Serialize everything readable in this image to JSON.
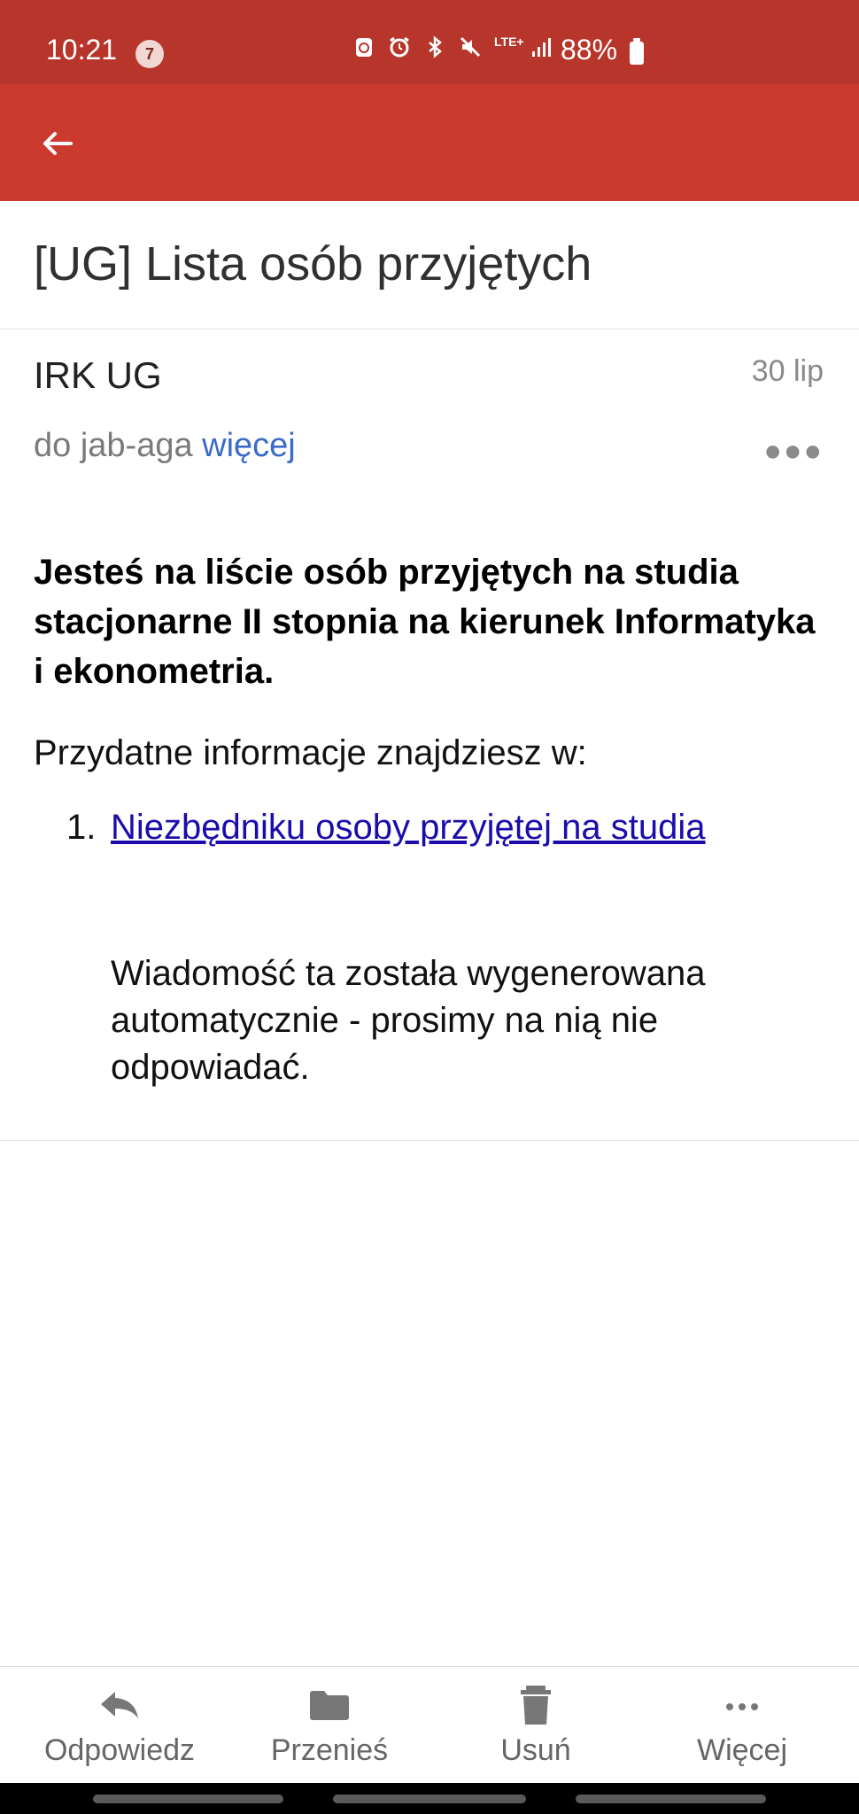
{
  "status_bar": {
    "time": "10:21",
    "notification_count": "7",
    "network": "LTE+",
    "battery": "88%"
  },
  "email": {
    "subject": "[UG] Lista osób przyjętych",
    "sender": "IRK UG",
    "date": "30 lip",
    "recipient_prefix": "do jab-aga",
    "more_label": "więcej",
    "heading": "Jesteś na liście osób przyjętych na studia stacjonarne II stopnia na kierunek Informatyka i ekonometria.",
    "intro": "Przydatne informacje znajdziesz w:",
    "list": [
      {
        "number": "1.",
        "link_text": "Niezbędniku osoby przyjętej na studia"
      }
    ],
    "auto_note": "Wiadomość ta została wygenerowana automatycznie - prosimy na nią nie odpowiadać."
  },
  "actions": [
    {
      "label": "Odpowiedz",
      "icon": "reply-icon"
    },
    {
      "label": "Przenieś",
      "icon": "folder-icon"
    },
    {
      "label": "Usuń",
      "icon": "trash-icon"
    },
    {
      "label": "Więcej",
      "icon": "more-horizontal-icon"
    }
  ],
  "colors": {
    "status_bar": "#b8352b",
    "app_bar": "#cc3a2f",
    "link": "#1a0dab",
    "more_link": "#3b6bc9"
  }
}
